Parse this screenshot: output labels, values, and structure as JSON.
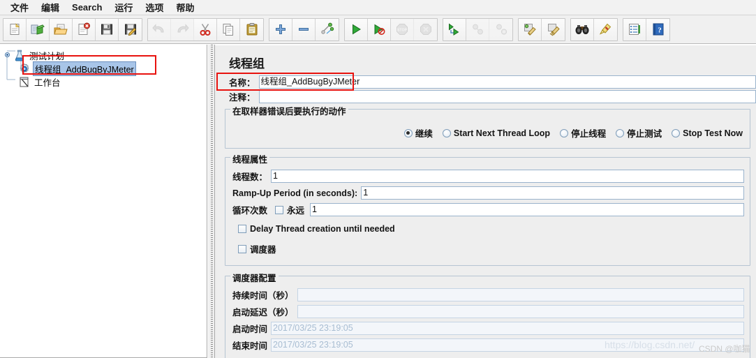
{
  "menubar": {
    "items": [
      {
        "label": "文件",
        "name": "menu-file"
      },
      {
        "label": "编辑",
        "name": "menu-edit"
      },
      {
        "label": "Search",
        "name": "menu-search"
      },
      {
        "label": "运行",
        "name": "menu-run"
      },
      {
        "label": "选项",
        "name": "menu-options"
      },
      {
        "label": "帮助",
        "name": "menu-help"
      }
    ]
  },
  "toolbar": {
    "groups": [
      {
        "buttons": [
          {
            "icon": "new-document-icon",
            "disabled": false
          },
          {
            "icon": "templates-icon",
            "disabled": false
          },
          {
            "icon": "open-folder-icon",
            "disabled": false
          },
          {
            "icon": "close-document-icon",
            "disabled": false
          },
          {
            "icon": "save-icon",
            "disabled": false
          },
          {
            "icon": "save-as-icon",
            "disabled": false
          }
        ]
      },
      {
        "buttons": [
          {
            "icon": "undo-icon",
            "disabled": true
          },
          {
            "icon": "redo-icon",
            "disabled": true
          },
          {
            "icon": "cut-icon",
            "disabled": false
          },
          {
            "icon": "copy-icon",
            "disabled": false
          },
          {
            "icon": "paste-icon",
            "disabled": false
          }
        ]
      },
      {
        "buttons": [
          {
            "icon": "expand-all-icon",
            "disabled": false
          },
          {
            "icon": "collapse-all-icon",
            "disabled": false
          },
          {
            "icon": "toggle-icon",
            "disabled": false
          }
        ]
      },
      {
        "buttons": [
          {
            "icon": "start-icon",
            "disabled": false
          },
          {
            "icon": "start-no-timers-icon",
            "disabled": false
          },
          {
            "icon": "stop-icon",
            "disabled": true
          },
          {
            "icon": "shutdown-icon",
            "disabled": true
          }
        ]
      },
      {
        "buttons": [
          {
            "icon": "remote-start-all-icon",
            "disabled": false
          },
          {
            "icon": "remote-stop-all-icon",
            "disabled": true
          },
          {
            "icon": "remote-shutdown-all-icon",
            "disabled": true
          }
        ]
      },
      {
        "buttons": [
          {
            "icon": "clear-icon",
            "disabled": false
          },
          {
            "icon": "clear-all-icon",
            "disabled": false
          }
        ]
      },
      {
        "buttons": [
          {
            "icon": "search-binoculars-icon",
            "disabled": false
          },
          {
            "icon": "reset-search-icon",
            "disabled": false
          }
        ]
      },
      {
        "buttons": [
          {
            "icon": "function-helper-icon",
            "disabled": false
          },
          {
            "icon": "help-icon",
            "disabled": false
          }
        ]
      }
    ]
  },
  "tree": {
    "nodes": [
      {
        "label": "测试计划",
        "icon": "test-plan-icon",
        "selected": false,
        "name": "tree-node-test-plan"
      },
      {
        "label": "线程组_AddBugByJMeter",
        "icon": "thread-group-icon",
        "selected": true,
        "name": "tree-node-thread-group"
      },
      {
        "label": "工作台",
        "icon": "workbench-icon",
        "selected": false,
        "name": "tree-node-workbench"
      }
    ]
  },
  "panel": {
    "title": "线程组",
    "name_label": "名称：",
    "name_value": "线程组_AddBugByJMeter",
    "comment_label": "注释：",
    "comment_value": "",
    "error_action": {
      "title": "在取样器错误后要执行的动作",
      "options": [
        {
          "label": "继续",
          "checked": true,
          "name": "radio-continue"
        },
        {
          "label": "Start Next Thread Loop",
          "checked": false,
          "name": "radio-start-next-thread-loop"
        },
        {
          "label": "停止线程",
          "checked": false,
          "name": "radio-stop-thread"
        },
        {
          "label": "停止测试",
          "checked": false,
          "name": "radio-stop-test"
        },
        {
          "label": "Stop Test Now",
          "checked": false,
          "name": "radio-stop-test-now"
        }
      ]
    },
    "thread_properties": {
      "title": "线程属性",
      "threads_label": "线程数：",
      "threads_value": "1",
      "rampup_label": "Ramp-Up Period (in seconds):",
      "rampup_value": "1",
      "loops_label": "循环次数",
      "forever_label": "永远",
      "forever_checked": false,
      "loops_value": "1",
      "delay_label": "Delay Thread creation until needed",
      "delay_checked": false,
      "scheduler_label": "调度器",
      "scheduler_checked": false
    },
    "scheduler_config": {
      "title": "调度器配置",
      "duration_label": "持续时间（秒）",
      "duration_value": "",
      "startup_delay_label": "启动延迟（秒）",
      "startup_delay_value": "",
      "start_time_label": "启动时间",
      "start_time_value": "2017/03/25 23:19:05",
      "end_time_label": "结束时间",
      "end_time_value": "2017/03/25 23:19:05"
    }
  },
  "watermark": {
    "url": "https://blog.csdn.net/",
    "user": "CSDN @咖猫"
  },
  "colors": {
    "annotation": "#e8120e",
    "selection": "#a8c5e8",
    "panel_bg": "#eeeeee"
  }
}
